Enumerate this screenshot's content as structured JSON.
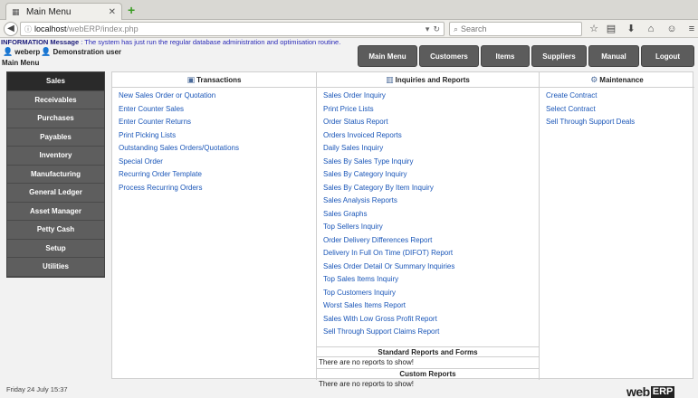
{
  "browser": {
    "tab_title": "Main Menu",
    "url_host": "localhost",
    "url_path": "/webERP/index.php",
    "search_placeholder": "Search"
  },
  "page": {
    "info_label": "INFORMATION Message",
    "info_text": " : The system has just run the regular database administration and optimisation routine.",
    "user_name": "weberp",
    "user_display": "Demonstration user",
    "breadcrumb": "Main Menu"
  },
  "menubar": [
    "Main Menu",
    "Customers",
    "Items",
    "Suppliers",
    "Manual",
    "Logout"
  ],
  "leftnav": {
    "items": [
      "Sales",
      "Receivables",
      "Purchases",
      "Payables",
      "Inventory",
      "Manufacturing",
      "General Ledger",
      "Asset Manager",
      "Petty Cash",
      "Setup",
      "Utilities"
    ]
  },
  "transactions": {
    "title": "Transactions",
    "links": [
      "New Sales Order or Quotation",
      "Enter Counter Sales",
      "Enter Counter Returns",
      "Print Picking Lists",
      "Outstanding Sales Orders/Quotations",
      "Special Order",
      "Recurring Order Template",
      "Process Recurring Orders"
    ]
  },
  "inquiries": {
    "title": "Inquiries and Reports",
    "links": [
      "Sales Order Inquiry",
      "Print Price Lists",
      "Order Status Report",
      "Orders Invoiced Reports",
      "Daily Sales Inquiry",
      "Sales By Sales Type Inquiry",
      "Sales By Category Inquiry",
      "Sales By Category By Item Inquiry",
      "Sales Analysis Reports",
      "Sales Graphs",
      "Top Sellers Inquiry",
      "Order Delivery Differences Report",
      "Delivery In Full On Time (DIFOT) Report",
      "Sales Order Detail Or Summary Inquiries",
      "Top Sales Items Inquiry",
      "Top Customers Inquiry",
      "Worst Sales Items Report",
      "Sales With Low Gross Profit Report",
      "Sell Through Support Claims Report"
    ],
    "standard_title": "Standard Reports and Forms",
    "standard_text": "There are no reports to show!",
    "custom_title": "Custom Reports",
    "custom_text": "There are no reports to show!"
  },
  "maintenance": {
    "title": "Maintenance",
    "links": [
      "Create Contract",
      "Select Contract",
      "Sell Through Support Deals"
    ]
  },
  "footer": {
    "date": "Friday 24 July 15:37",
    "logo_a": "web",
    "logo_b": "ERP"
  }
}
